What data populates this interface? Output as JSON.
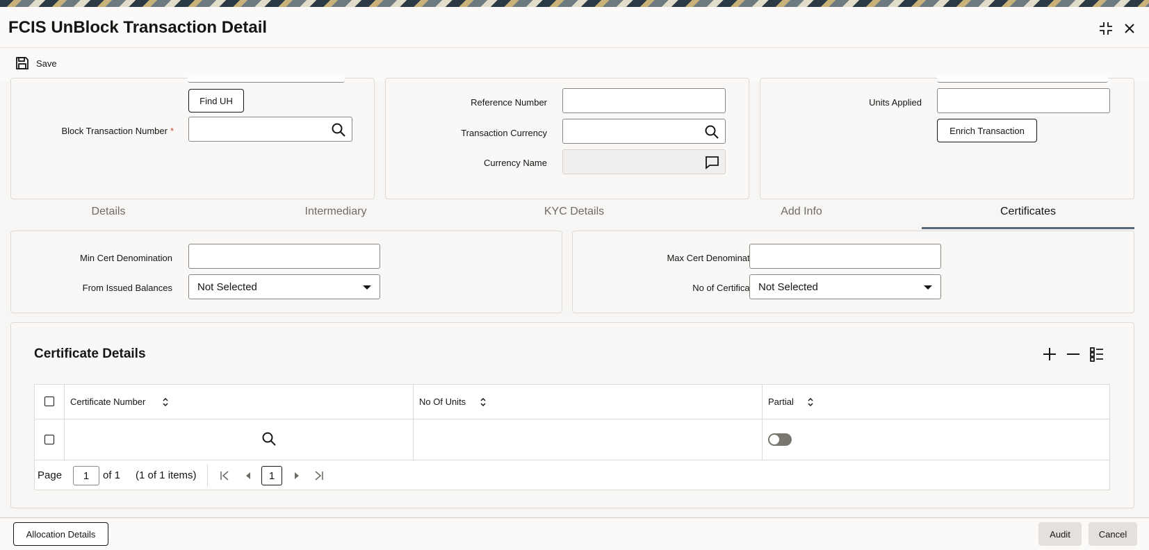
{
  "window": {
    "title": "FCIS UnBlock Transaction Detail"
  },
  "toolbar": {
    "save_label": "Save"
  },
  "header_left": {
    "find_uh_label": "Find UH",
    "block_txn_label": "Block Transaction Number",
    "block_txn_required_mark": "*",
    "block_txn_value": ""
  },
  "header_mid": {
    "reference_label": "Reference Number",
    "txn_currency_label": "Transaction Currency",
    "currency_name_label": "Currency Name"
  },
  "header_right": {
    "units_applied_label": "Units Applied",
    "enrich_label": "Enrich Transaction"
  },
  "tabs": [
    {
      "label": "Details"
    },
    {
      "label": "Intermediary"
    },
    {
      "label": "KYC Details"
    },
    {
      "label": "Add Info"
    },
    {
      "label": "Certificates"
    }
  ],
  "cert_form": {
    "min_cert_label": "Min Cert Denomination",
    "from_issued_label": "From Issued Balances",
    "from_issued_value": "Not Selected",
    "max_cert_label": "Max Cert Denomination",
    "no_certs_label": "No of Certificates",
    "no_certs_value": "Not Selected"
  },
  "cert_details": {
    "title": "Certificate Details",
    "columns": [
      "Certificate Number",
      "No Of Units",
      "Partial"
    ],
    "pager": {
      "page_label": "Page",
      "page_value": "1",
      "of_label": "of 1",
      "items_label": "(1 of 1 items)",
      "current_page": "1"
    }
  },
  "footer": {
    "allocation_label": "Allocation Details",
    "audit_label": "Audit",
    "cancel_label": "Cancel"
  }
}
